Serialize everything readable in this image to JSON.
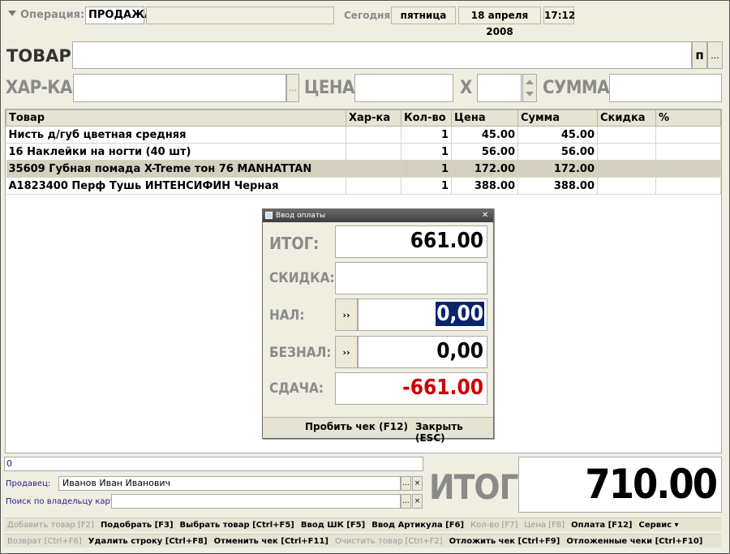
{
  "header": {
    "operation_label": "Операция:",
    "operation_value": "ПРОДАЖА",
    "today_label": "Сегодня:",
    "weekday": "пятница",
    "date": "18 апреля 2008",
    "time": "17:12"
  },
  "entry": {
    "tovar_label": "ТОВАР:",
    "tovar_p_button": "п",
    "tovar_dots": "...",
    "harka_label": "ХАР-КА:",
    "harka_dots": "...",
    "price_label": "ЦЕНА:",
    "times_label": "Х",
    "sum_label": "СУММА:"
  },
  "table": {
    "columns": [
      "Товар",
      "Хар-ка",
      "Кол-во",
      "Цена",
      "Сумма",
      "Скидка",
      "%"
    ],
    "rows": [
      {
        "name": "Нисть д/губ цветная средняя",
        "char": "",
        "qty": "1",
        "price": "45.00",
        "sum": "45.00",
        "discount": "",
        "pct": ""
      },
      {
        "name": "16 Наклейки на ногти (40 шт)",
        "char": "",
        "qty": "1",
        "price": "56.00",
        "sum": "56.00",
        "discount": "",
        "pct": ""
      },
      {
        "name": "35609 Губная помада X-Treme  тон 76 MANHATTAN",
        "char": "",
        "qty": "1",
        "price": "172.00",
        "sum": "172.00",
        "discount": "",
        "pct": ""
      },
      {
        "name": "А1823400 Перф Тушь ИНТЕНСИФИН Черная",
        "char": "",
        "qty": "1",
        "price": "388.00",
        "sum": "388.00",
        "discount": "",
        "pct": ""
      }
    ]
  },
  "dialog": {
    "title": "Ввод оплаты",
    "close": "✕",
    "total_label": "ИТОГ:",
    "total_value": "661.00",
    "discount_label": "СКИДКА:",
    "cash_label": "НАЛ:",
    "cash_btn": "››",
    "cash_value": "0,00",
    "card_label": "БЕЗНАЛ:",
    "card_btn": "››",
    "card_value": "0,00",
    "change_label": "СДАЧА:",
    "change_value": "-661.00",
    "print_button": "Пробить чек (F12)",
    "close_button": "Закрыть (ESC)"
  },
  "footer": {
    "counter": "0",
    "seller_label": "Продавец:",
    "seller_value": "Иванов Иван Иванович",
    "card_search_label": "Поиск по владельцу карты:",
    "card_search_value": "",
    "total_label": "ИТОГ:",
    "total_value": "710.00",
    "dots": "...",
    "clear": "×"
  },
  "function_bar_1": [
    {
      "label": "Добавить товар [F2]",
      "enabled": false
    },
    {
      "label": "Подобрать [F3]",
      "enabled": true
    },
    {
      "label": "Выбрать товар [Ctrl+F5]",
      "enabled": true
    },
    {
      "label": "Ввод ШК [F5]",
      "enabled": true
    },
    {
      "label": "Ввод Артикула [F6]",
      "enabled": true
    },
    {
      "label": "Кол-во [F7]",
      "enabled": false
    },
    {
      "label": "Цена [F8]",
      "enabled": false
    },
    {
      "label": "Оплата [F12]",
      "enabled": true
    },
    {
      "label": "Сервис ▾",
      "enabled": true
    }
  ],
  "function_bar_2": [
    {
      "label": "Возврат [Ctrl+F6]",
      "enabled": false
    },
    {
      "label": "Удалить строку [Ctrl+F8]",
      "enabled": true
    },
    {
      "label": "Отменить чек [Ctrl+F11]",
      "enabled": true
    },
    {
      "label": "Очистить товар [Ctrl+F2]",
      "enabled": false
    },
    {
      "label": "Отложить чек [Ctrl+F9]",
      "enabled": true
    },
    {
      "label": "Отложенные чеки [Ctrl+F10]",
      "enabled": true
    }
  ],
  "colors": {
    "selection": "#0a246a",
    "negative": "#cc0000",
    "label_gray": "#8a8a8a",
    "link_blue": "#1f1f8f"
  }
}
